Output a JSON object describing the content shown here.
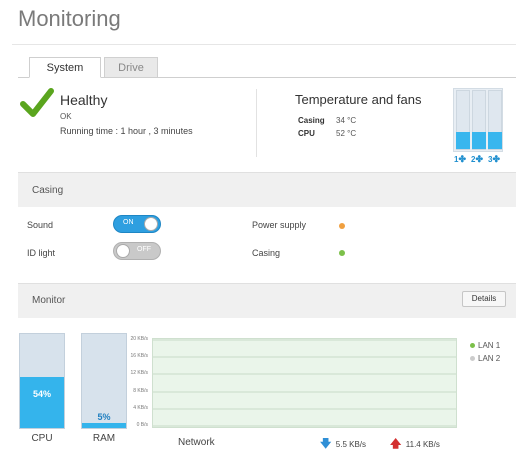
{
  "page": {
    "title": "Monitoring"
  },
  "tabs": [
    {
      "label": "System",
      "active": true
    },
    {
      "label": "Drive",
      "active": false
    }
  ],
  "health": {
    "title": "Healthy",
    "status": "OK",
    "runtime": "Running time : 1 hour , 3 minutes",
    "icon": "check-icon"
  },
  "temperature": {
    "title": "Temperature and fans",
    "rows": [
      {
        "label": "Casing",
        "value": "34 °C"
      },
      {
        "label": "CPU",
        "value": "52 °C"
      }
    ],
    "fans": [
      {
        "label": "1",
        "level": 0.3
      },
      {
        "label": "2",
        "level": 0.3
      },
      {
        "label": "3",
        "level": 0.3
      }
    ],
    "fan_icon": "fan-icon"
  },
  "casing": {
    "title": "Casing",
    "sound": {
      "label": "Sound",
      "state": "ON"
    },
    "idlight": {
      "label": "ID light",
      "state": "OFF"
    },
    "power": {
      "label": "Power supply",
      "status_color": "#f0a040"
    },
    "casing_status": {
      "label": "Casing",
      "status_color": "#7cc04a"
    }
  },
  "monitor": {
    "title": "Monitor",
    "details_label": "Details",
    "cpu": {
      "label": "CPU",
      "value": "54%",
      "level": 0.54
    },
    "ram": {
      "label": "RAM",
      "value": "5%",
      "level": 0.05
    },
    "network_label": "Network",
    "download": "5.5 KB/s",
    "upload": "11.4 KB/s",
    "legend": [
      {
        "label": "LAN 1",
        "color": "#7cc04a"
      },
      {
        "label": "LAN 2",
        "color": "#cccccc"
      }
    ]
  },
  "chart_data": {
    "type": "line",
    "yticks": [
      "20 KB/s",
      "16 KB/s",
      "12 KB/s",
      "8 KB/s",
      "4 KB/s",
      "0 B/s"
    ],
    "ylim": [
      0,
      20
    ],
    "series": [
      {
        "name": "LAN 1",
        "values": []
      },
      {
        "name": "LAN 2",
        "values": []
      }
    ]
  },
  "colors": {
    "accent": "#2e9fe0",
    "check": "#5aa51e",
    "download_arrow": "#2f8fd6",
    "upload_arrow": "#d32f2f"
  }
}
